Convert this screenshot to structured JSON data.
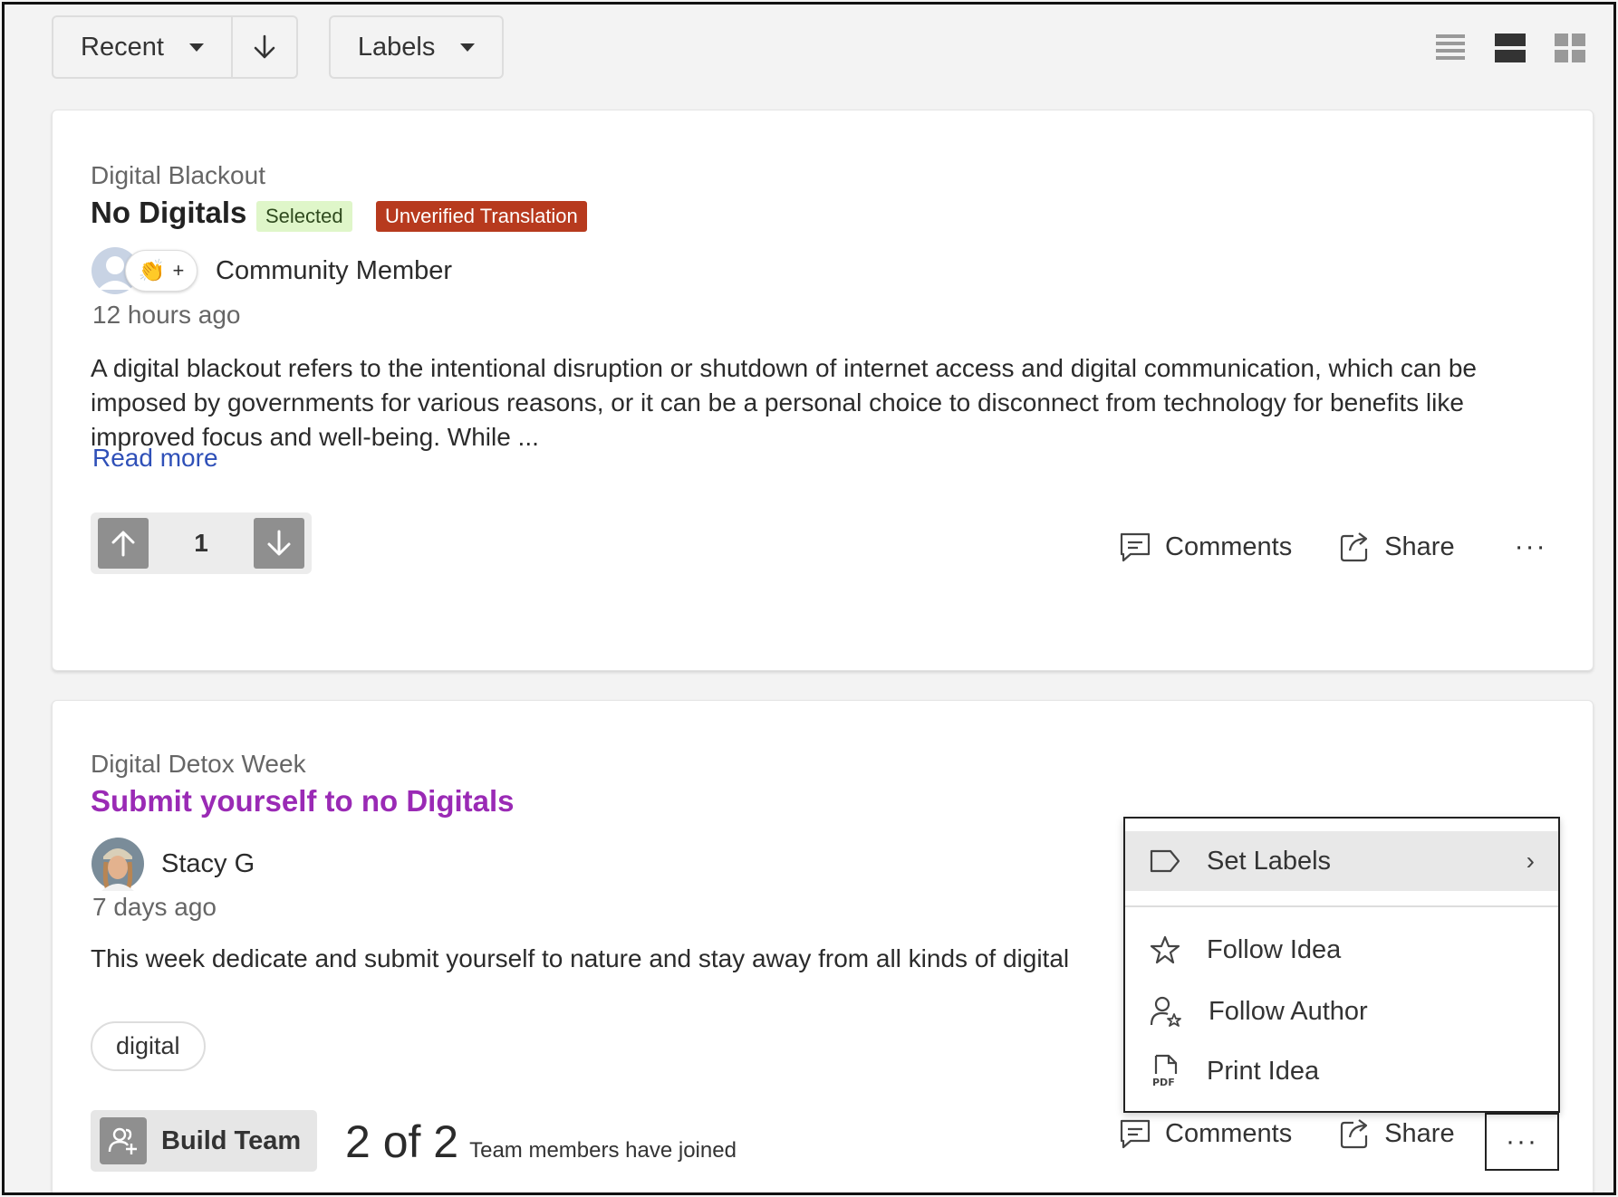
{
  "toolbar": {
    "sort_label": "Recent",
    "labels_label": "Labels"
  },
  "ideas": [
    {
      "campaign": "Digital Blackout",
      "title": "No Digitals",
      "badges": [
        "Selected",
        "Unverified Translation"
      ],
      "author": "Community Member",
      "time": "12 hours ago",
      "description": "A digital blackout refers to the intentional disruption or shutdown of internet access and digital communication, which can be imposed by governments for various reasons, or it can be a personal choice to disconnect from technology for benefits like improved focus and well-being. While ...",
      "read_more": "Read more",
      "votes": "1",
      "comments_label": "Comments",
      "share_label": "Share",
      "more_label": "···"
    },
    {
      "campaign": "Digital Detox Week",
      "title": "Submit yourself to no Digitals",
      "author": "Stacy G",
      "time": "7 days ago",
      "description": "This week dedicate and submit yourself to nature and stay away from all kinds of digital",
      "tag": "digital",
      "build_team_label": "Build Team",
      "team_count": "2 of 2",
      "team_text": "Team members have joined",
      "comments_label": "Comments",
      "share_label": "Share",
      "more_label": "···"
    }
  ],
  "context_menu": {
    "items": [
      "Set Labels",
      "Follow Idea",
      "Follow Author",
      "Print Idea"
    ],
    "chevron": "›"
  },
  "colors": {
    "accent_link": "#2f50b8",
    "title_link": "#9a2ab5",
    "badge_selected": "#dff6c9",
    "badge_unverified": "#b73a1e"
  }
}
